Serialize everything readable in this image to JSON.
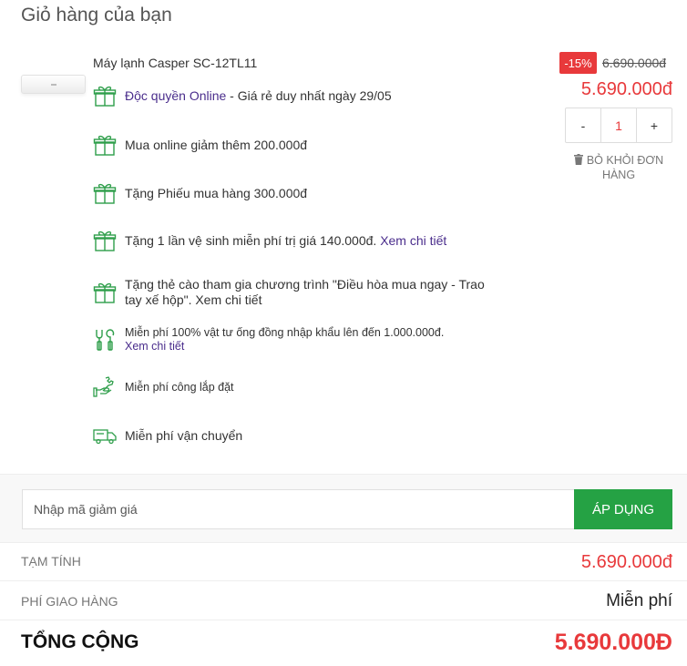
{
  "page_title": "Giỏ hàng của bạn",
  "product": {
    "name": "Máy lạnh Casper SC-12TL11",
    "discount_badge": "-15%",
    "old_price": "6.690.000đ",
    "new_price": "5.690.000đ",
    "quantity": "1",
    "qty_minus": "-",
    "qty_plus": "+",
    "remove_label": "BỎ KHỎI ĐƠN HÀNG"
  },
  "promotions": [
    {
      "icon": "gift-icon",
      "accent": "Độc quyền Online",
      "text": " - Giá rẻ duy nhất ngày 29/05",
      "link": ""
    },
    {
      "icon": "gift-icon",
      "accent": "",
      "text": "Mua online giảm thêm 200.000đ",
      "link": ""
    },
    {
      "icon": "gift-icon",
      "accent": "",
      "text": "Tặng Phiếu mua hàng 300.000đ",
      "link": ""
    },
    {
      "icon": "gift-icon",
      "accent": "",
      "text": "Tặng 1 lần vệ sinh miễn phí trị giá 140.000đ. ",
      "link": "Xem chi tiết"
    },
    {
      "icon": "gift-icon",
      "accent": "",
      "text": "Tặng thẻ cào tham gia chương trình \"Điều hòa mua ngay - Trao tay xế hộp\". Xem chi tiết",
      "link": ""
    },
    {
      "icon": "tools-icon",
      "accent": "",
      "text": "Miễn phí 100% vật tư ống đồng nhập khẩu lên đến 1.000.000đ.",
      "link": "Xem chi tiết"
    },
    {
      "icon": "wrench-hand-icon",
      "accent": "",
      "text": "Miễn phí công lắp đặt",
      "link": ""
    },
    {
      "icon": "truck-icon",
      "accent": "",
      "text": "Miễn phí vận chuyển",
      "link": ""
    }
  ],
  "coupon": {
    "placeholder": "Nhập mã giảm giá",
    "apply_label": "ÁP DỤNG"
  },
  "summary": {
    "subtotal_label": "TẠM TÍNH",
    "subtotal_value": "5.690.000đ",
    "shipping_label": "PHÍ GIAO HÀNG",
    "shipping_value": "Miễn phí",
    "total_label": "TỔNG CỘNG",
    "total_value": "5.690.000Đ"
  },
  "colors": {
    "accent_red": "#e8393b",
    "apply_green": "#25a244",
    "promo_icon_green": "#2e9e4a",
    "link_purple": "#4a2d8c"
  }
}
